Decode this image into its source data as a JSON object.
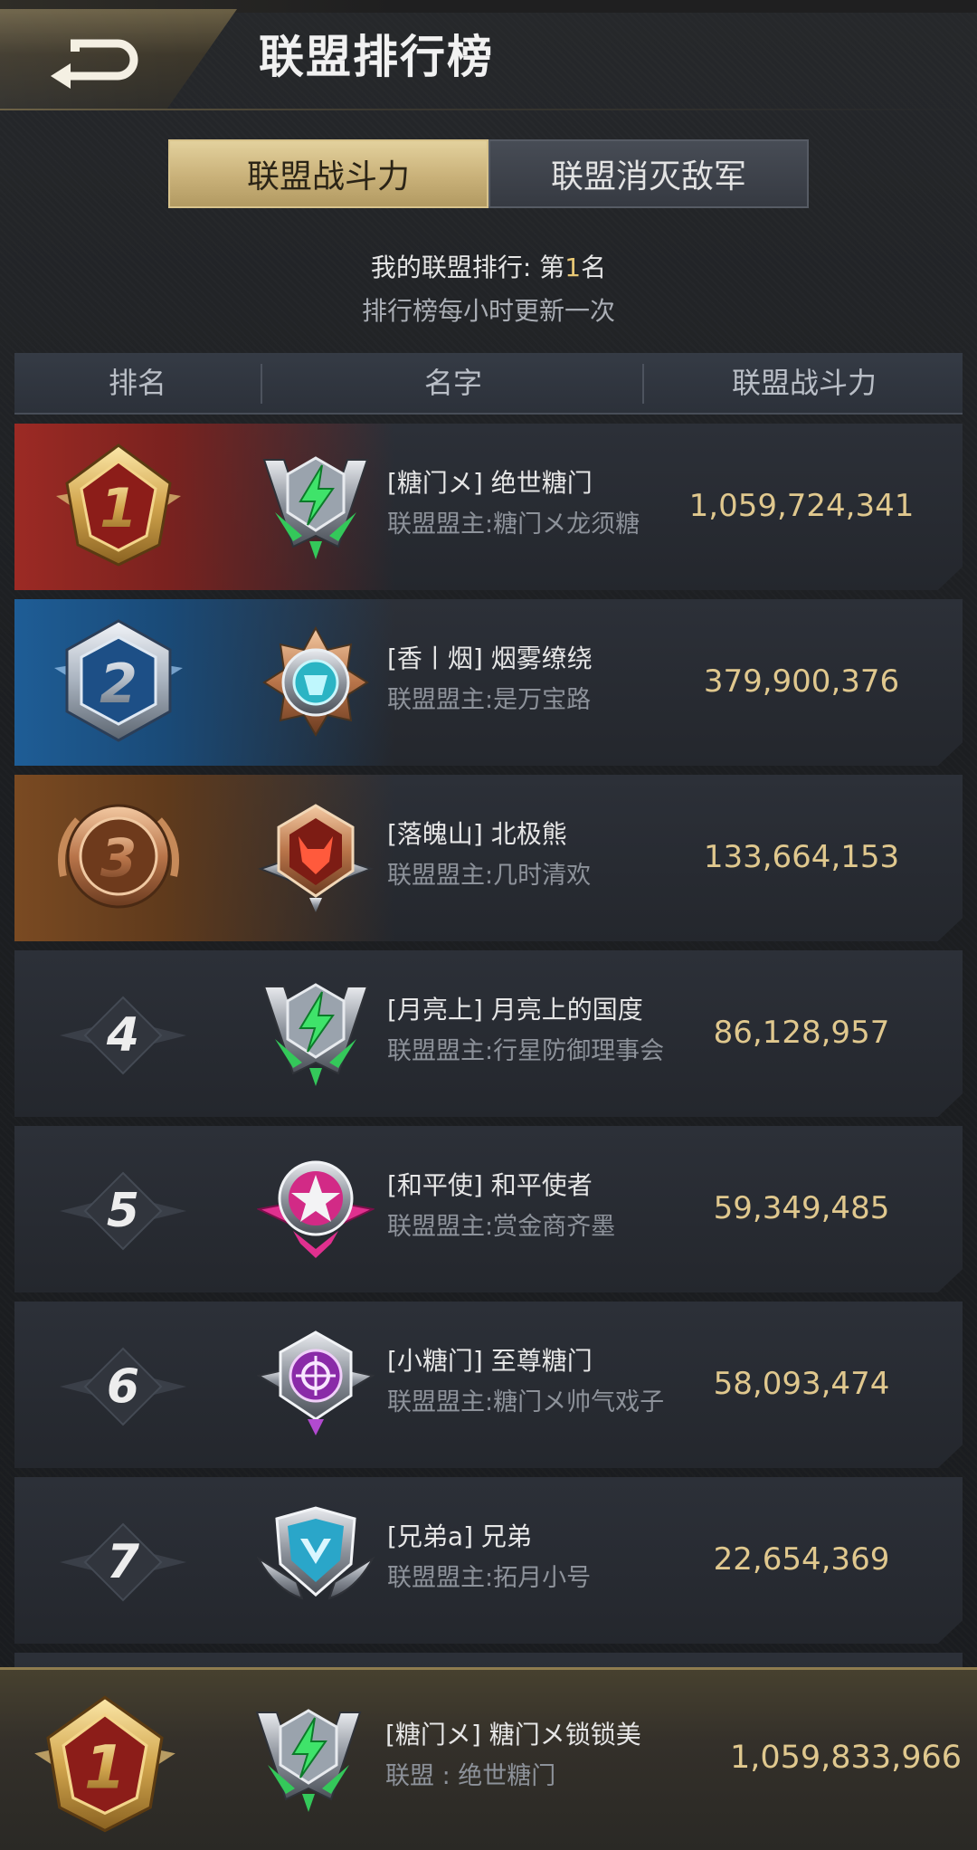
{
  "header": {
    "title": "联盟排行榜"
  },
  "tabs": [
    {
      "label": "联盟战斗力",
      "active": true
    },
    {
      "label": "联盟消灭敌军",
      "active": false
    }
  ],
  "my_rank": {
    "prefix": "我的联盟排行: 第",
    "rank": "1",
    "suffix": "名"
  },
  "update_note": "排行榜每小时更新一次",
  "columns": {
    "rank": "排名",
    "name": "名字",
    "power": "联盟战斗力"
  },
  "rows": [
    {
      "rank": "1",
      "name": "[糖门メ] 绝世糖门",
      "leader": "联盟盟主:糖门メ龙须糖",
      "power": "1,059,724,341",
      "emblem": "green-lightning-emblem"
    },
    {
      "rank": "2",
      "name": "[香丨烟] 烟雾缭绕",
      "leader": "联盟盟主:是万宝路",
      "power": "379,900,376",
      "emblem": "cyan-star-emblem"
    },
    {
      "rank": "3",
      "name": "[落魄山] 北极熊",
      "leader": "联盟盟主:几时清欢",
      "power": "133,664,153",
      "emblem": "red-wolf-emblem"
    },
    {
      "rank": "4",
      "name": "[月亮上] 月亮上的国度",
      "leader": "联盟盟主:行星防御理事会",
      "power": "86,128,957",
      "emblem": "green-lightning-emblem"
    },
    {
      "rank": "5",
      "name": "[和平使] 和平使者",
      "leader": "联盟盟主:赏金商齐墨",
      "power": "59,349,485",
      "emblem": "pink-star-emblem"
    },
    {
      "rank": "6",
      "name": "[小糖门] 至尊糖门",
      "leader": "联盟盟主:糖门メ帅气戏子",
      "power": "58,093,474",
      "emblem": "purple-target-emblem"
    },
    {
      "rank": "7",
      "name": "[兄弟a] 兄弟",
      "leader": "联盟盟主:拓月小号",
      "power": "22,654,369",
      "emblem": "blue-shield-emblem"
    }
  ],
  "my_alliance": {
    "rank": "1",
    "name": "[糖门メ] 糖门メ锁锁美",
    "alliance": "联盟 : 绝世糖门",
    "power": "1,059,833,966",
    "emblem": "green-lightning-emblem"
  },
  "colors": {
    "gold": "#e0c88e",
    "rank1": "#9c2a24",
    "rank2": "#1e5d96",
    "rank3": "#7a4a22"
  }
}
